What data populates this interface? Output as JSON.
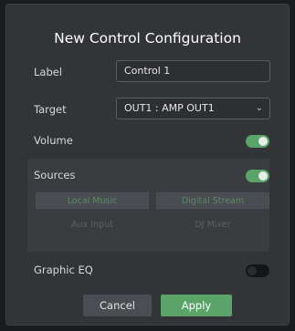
{
  "dialog": {
    "title": "New Control Configuration",
    "label_field": {
      "label": "Label",
      "value": "Control 1"
    },
    "target_field": {
      "label": "Target",
      "value": "OUT1 : AMP OUT1"
    },
    "volume": {
      "label": "Volume",
      "enabled": true
    },
    "sources": {
      "label": "Sources",
      "enabled": true,
      "options": [
        {
          "label": "Local Music",
          "active": true
        },
        {
          "label": "Digital Stream",
          "active": true
        },
        {
          "label": "Aux Input",
          "active": false
        },
        {
          "label": "DJ Mixer",
          "active": false
        }
      ]
    },
    "graphic_eq": {
      "label": "Graphic EQ",
      "enabled": false
    },
    "cancel_label": "Cancel",
    "apply_label": "Apply"
  },
  "colors": {
    "accent_green": "#5aa469",
    "background": "#323437"
  },
  "icons": {
    "select_chevron": "chevron-down-icon"
  }
}
